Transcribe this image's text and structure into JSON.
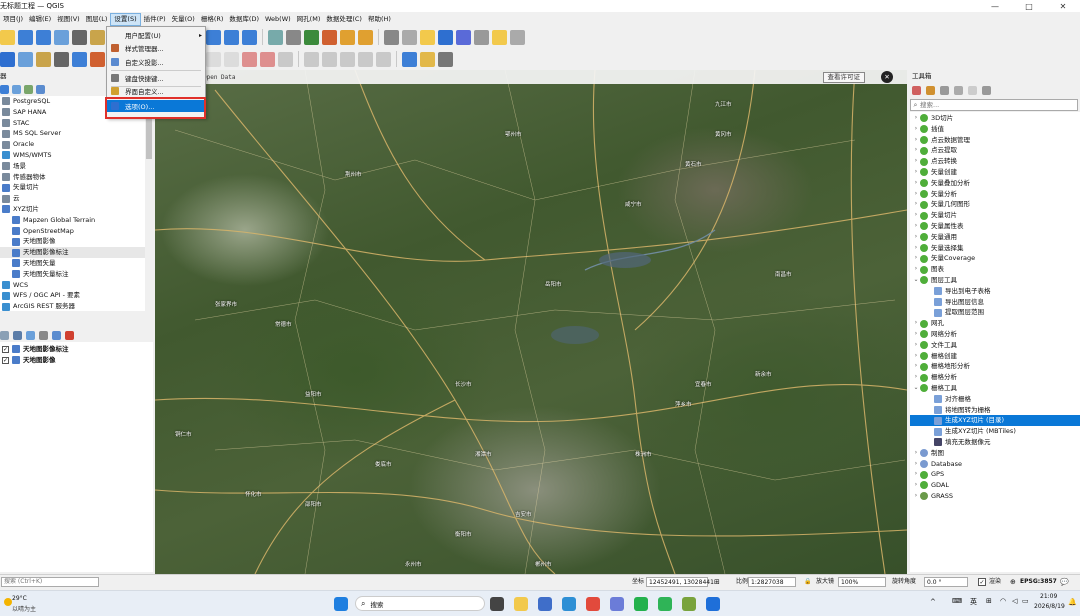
{
  "window": {
    "title": "无标题工程 — QGIS",
    "minimize": "—",
    "maximize": "□",
    "close": "✕"
  },
  "menubar": [
    "项目(J)",
    "编辑(E)",
    "视图(V)",
    "图层(L)",
    "设置(S)",
    "插件(P)",
    "矢量(O)",
    "栅格(R)",
    "数据库(D)",
    "Web(W)",
    "网孔(M)",
    "数据处理(C)",
    "帮助(H)"
  ],
  "settings_menu": {
    "items": [
      {
        "label": "用户配置(U)",
        "has_submenu": true
      },
      {
        "label": "样式管理器..."
      },
      {
        "label": "自定义投影..."
      },
      {
        "label": "键盘快捷键..."
      },
      {
        "label": "界面自定义..."
      },
      {
        "label": "选项(O)...",
        "selected": true
      }
    ]
  },
  "browser": {
    "title": "器",
    "items": [
      {
        "label": "PostgreSQL",
        "icon": "postgresql-icon"
      },
      {
        "label": "SAP HANA",
        "icon": "database-icon"
      },
      {
        "label": "STAC",
        "icon": "stac-icon"
      },
      {
        "label": "MS SQL Server",
        "icon": "database-icon"
      },
      {
        "label": "Oracle",
        "icon": "oracle-icon"
      },
      {
        "label": "WMS/WMTS",
        "icon": "globe-icon"
      },
      {
        "label": "场景",
        "icon": "scene-icon"
      },
      {
        "label": "传感器物体",
        "icon": "sensor-icon"
      },
      {
        "label": "矢量切片",
        "icon": "grid-icon"
      },
      {
        "label": "云",
        "icon": "cloud-icon"
      },
      {
        "label": "XYZ切片",
        "icon": "grid-icon"
      },
      {
        "label": "Mapzen Global Terrain",
        "icon": "grid-icon",
        "indent": 1
      },
      {
        "label": "OpenStreetMap",
        "icon": "grid-icon",
        "indent": 1
      },
      {
        "label": "天地图影像",
        "icon": "grid-icon",
        "indent": 1
      },
      {
        "label": "天地图影像标注",
        "icon": "grid-icon",
        "indent": 1,
        "highlight": true
      },
      {
        "label": "天地图矢量",
        "icon": "grid-icon",
        "indent": 1
      },
      {
        "label": "天地图矢量标注",
        "icon": "grid-icon",
        "indent": 1
      },
      {
        "label": "WCS",
        "icon": "globe-icon"
      },
      {
        "label": "WFS / OGC API - 要素",
        "icon": "globe-icon"
      },
      {
        "label": "ArcGIS REST 服务器",
        "icon": "globe-icon"
      }
    ]
  },
  "layers": {
    "items": [
      {
        "label": "天地图影像标注",
        "checked": true
      },
      {
        "label": "天地图影像",
        "checked": true
      }
    ]
  },
  "map": {
    "attribution": "Open Data",
    "license_button": "查看许可证",
    "close": "✕",
    "cities": [
      "荆州市",
      "鄂州市",
      "咸宁市",
      "黄石市",
      "黄冈市",
      "岳阳市",
      "九江市",
      "常德市",
      "益阳市",
      "长沙市",
      "湘潭市",
      "株洲市",
      "萍乡市",
      "娄底市",
      "邵阳市",
      "衡阳市",
      "宜春市",
      "新余市",
      "怀化市",
      "永州市",
      "郴州市",
      "张家界市",
      "南昌市",
      "吉安市",
      "铜仁市"
    ]
  },
  "toolbox": {
    "title": "工具箱",
    "search_placeholder": "搜索...",
    "groups": [
      {
        "label": "3D切片",
        "expanded": false
      },
      {
        "label": "插值",
        "expanded": false
      },
      {
        "label": "点云数据管理",
        "expanded": false
      },
      {
        "label": "点云提取",
        "expanded": false
      },
      {
        "label": "点云转换",
        "expanded": false
      },
      {
        "label": "矢量创建",
        "expanded": false
      },
      {
        "label": "矢量叠加分析",
        "expanded": false
      },
      {
        "label": "矢量分析",
        "expanded": false
      },
      {
        "label": "矢量几何图形",
        "expanded": false
      },
      {
        "label": "矢量切片",
        "expanded": false
      },
      {
        "label": "矢量属性表",
        "expanded": false
      },
      {
        "label": "矢量通用",
        "expanded": false
      },
      {
        "label": "矢量选择集",
        "expanded": false
      },
      {
        "label": "矢量Coverage",
        "expanded": false
      },
      {
        "label": "图表",
        "expanded": false
      },
      {
        "label": "图层工具",
        "expanded": true,
        "children": [
          "导出到电子表格",
          "导出图层信息",
          "提取图层范围"
        ]
      },
      {
        "label": "网孔",
        "expanded": false
      },
      {
        "label": "网络分析",
        "expanded": false
      },
      {
        "label": "文件工具",
        "expanded": false
      },
      {
        "label": "栅格创建",
        "expanded": false
      },
      {
        "label": "栅格地形分析",
        "expanded": false
      },
      {
        "label": "栅格分析",
        "expanded": false
      },
      {
        "label": "栅格工具",
        "expanded": true,
        "children": [
          "对齐栅格",
          "将地图转为栅格",
          "生成XYZ切片 (目录)",
          "生成XYZ切片 (MBTiles)",
          "填充无数据像元"
        ],
        "selected_child": 2
      },
      {
        "label": "制图",
        "expanded": false
      },
      {
        "label": "Database",
        "expanded": false
      },
      {
        "label": "GPS",
        "expanded": false
      },
      {
        "label": "GDAL",
        "expanded": false
      },
      {
        "label": "GRASS",
        "expanded": false
      }
    ]
  },
  "statusbar": {
    "locator_placeholder": "搜索 (Ctrl+K)",
    "coord_label": "坐标",
    "coord_value": "12452491, 13028441",
    "scale_label": "比例",
    "scale_value": "1:2827038",
    "magnifier_label": "放大镜",
    "magnifier_value": "100%",
    "rotation_label": "旋转角度",
    "rotation_value": "0.0 °",
    "render_label": "渲染",
    "crs": "EPSG:3857"
  },
  "taskbar": {
    "weather_temp": "29°C",
    "weather_desc": "以晴为主",
    "search_label": "搜索",
    "ime": "英",
    "time": "21:09",
    "date": "2026/8/19"
  }
}
